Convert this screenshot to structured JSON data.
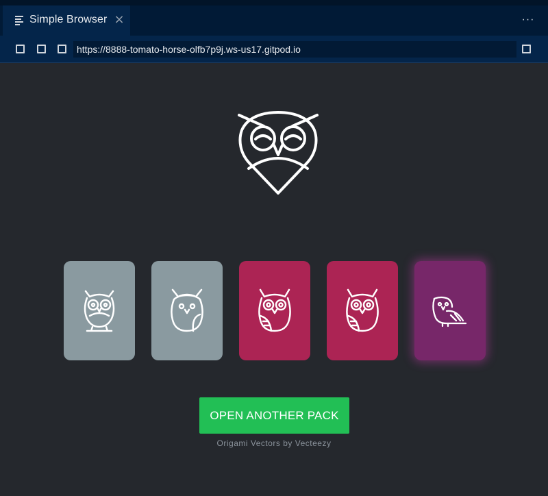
{
  "tab": {
    "title": "Simple Browser",
    "icon": "preview-lines-icon",
    "close_glyph": "×"
  },
  "toolbar": {
    "more_glyph": "···",
    "url": "https://8888-tomato-horse-olfb7p9j.ws-us17.gitpod.io"
  },
  "main": {
    "logo_icon": "owl-pin-logo",
    "cards": [
      {
        "color": "#8a9aa0",
        "icon": "owl-standing-icon"
      },
      {
        "color": "#8a9aa0",
        "icon": "owl-half-icon"
      },
      {
        "color": "#ac2454",
        "icon": "owl-wing-icon"
      },
      {
        "color": "#ac2454",
        "icon": "owl-wing-icon"
      },
      {
        "color": "#772769",
        "icon": "owl-perched-icon"
      }
    ],
    "button_label": "OPEN ANOTHER PACK",
    "credit": "Origami Vectors by Vecteezy"
  },
  "colors": {
    "background": "#25282d",
    "tab_bar": "#011a36",
    "accent_button": "#22bf55"
  }
}
